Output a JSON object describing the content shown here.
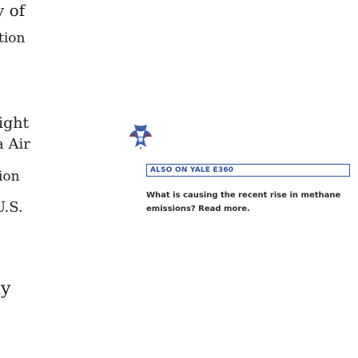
{
  "left_column": {
    "fragments": [
      "y of",
      "tion",
      "ight",
      "a Air",
      "ion",
      "U.S.",
      "ly"
    ]
  },
  "story": {
    "logo_icon": "yale-e360-logo-icon",
    "tag_label": "ALSO ON YALE E360",
    "headline": "What is causing the recent rise in methane emissions? Read more."
  }
}
